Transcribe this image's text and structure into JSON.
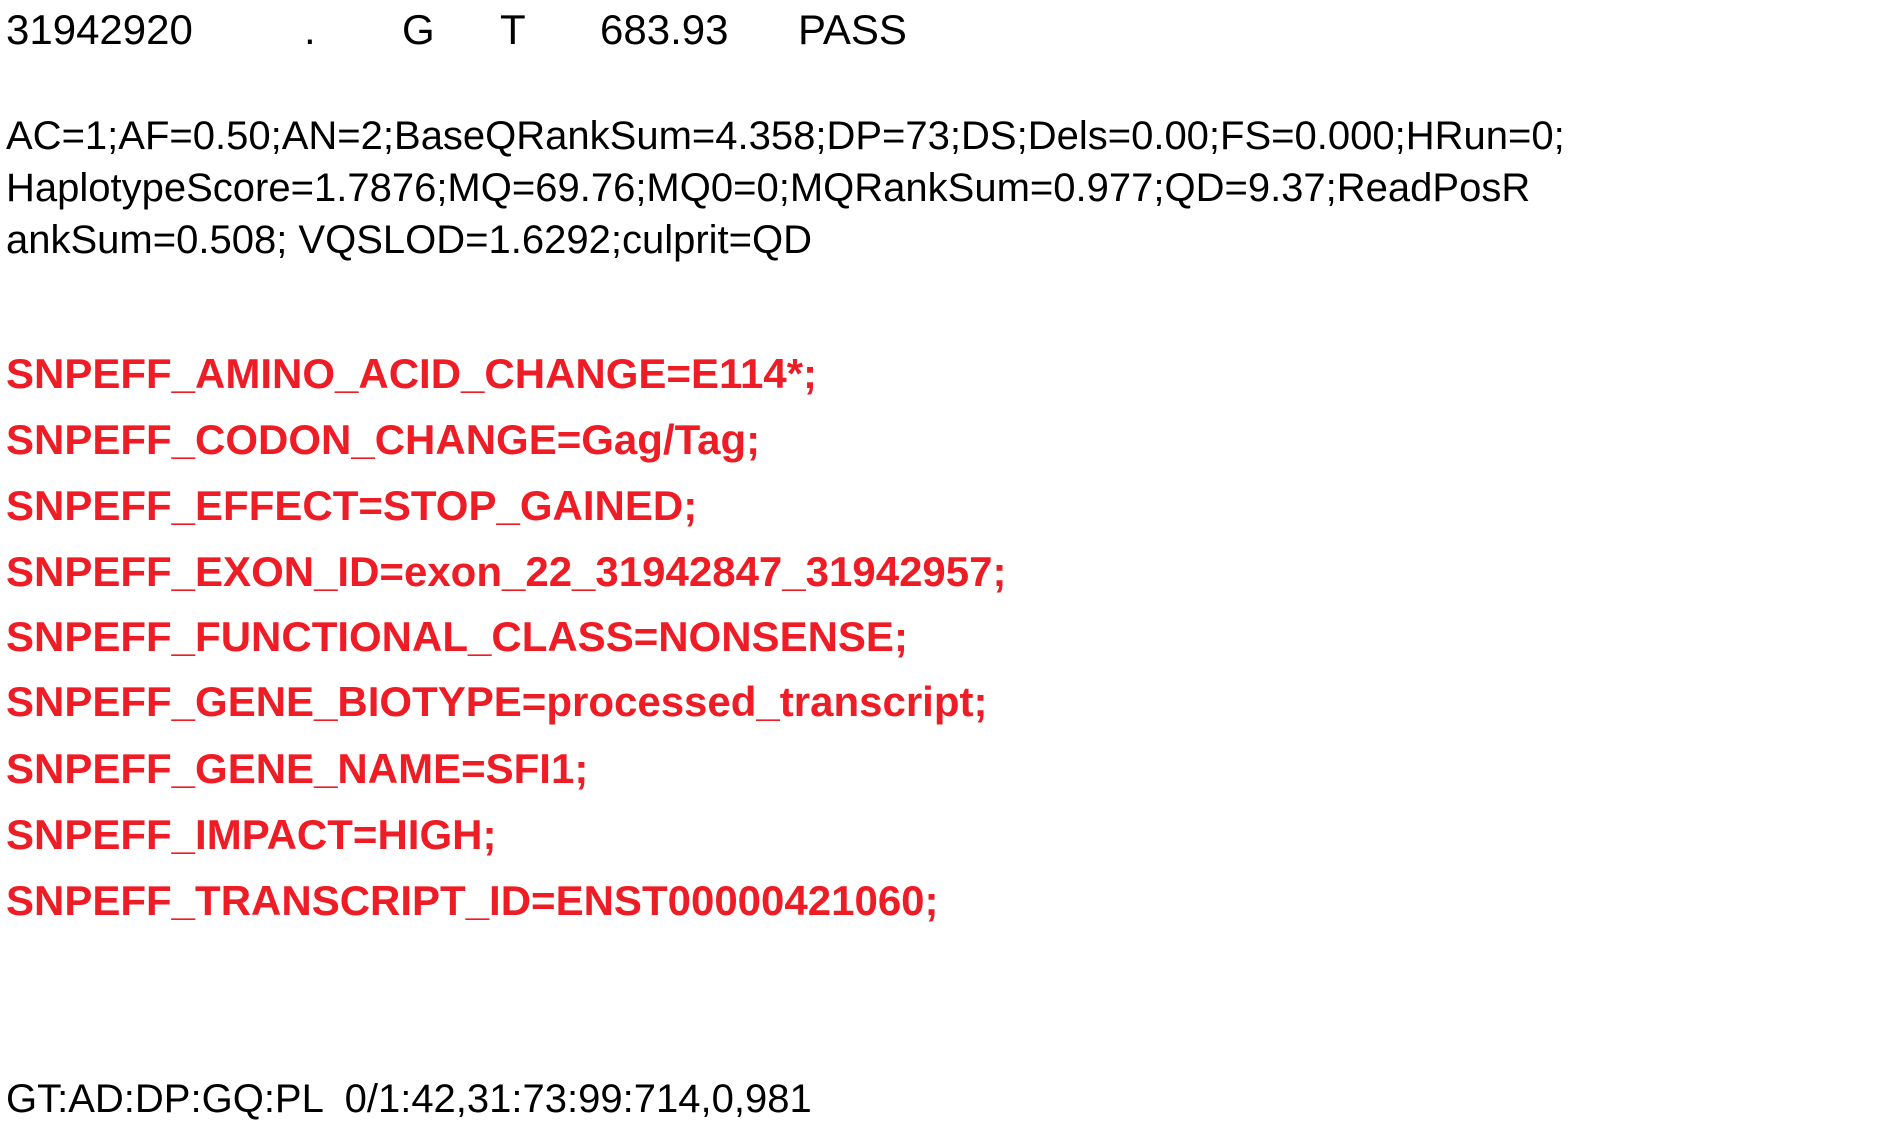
{
  "record": {
    "pos": "31942920",
    "id": ".",
    "ref": "G",
    "alt": "T",
    "qual": "683.93",
    "filter": "PASS"
  },
  "info_lines": [
    "AC=1;AF=0.50;AN=2;BaseQRankSum=4.358;DP=73;DS;Dels=0.00;FS=0.000;HRun=0;",
    "HaplotypeScore=1.7876;MQ=69.76;MQ0=0;MQRankSum=0.977;QD=9.37;ReadPosR",
    "ankSum=0.508; VQSLOD=1.6292;culprit=QD"
  ],
  "snpeff_lines": [
    "SNPEFF_AMINO_ACID_CHANGE=E114*;",
    "SNPEFF_CODON_CHANGE=Gag/Tag;",
    "SNPEFF_EFFECT=STOP_GAINED;",
    "SNPEFF_EXON_ID=exon_22_31942847_31942957;",
    "SNPEFF_FUNCTIONAL_CLASS=NONSENSE;",
    "SNPEFF_GENE_BIOTYPE=processed_transcript;",
    "SNPEFF_GENE_NAME=SFI1;",
    "SNPEFF_IMPACT=HIGH;",
    "SNPEFF_TRANSCRIPT_ID=ENST00000421060;"
  ],
  "format_line": "GT:AD:DP:GQ:PL  0/1:42,31:73:99:714,0,981",
  "colors": {
    "highlight": "#ee1c25",
    "text": "#000000"
  }
}
